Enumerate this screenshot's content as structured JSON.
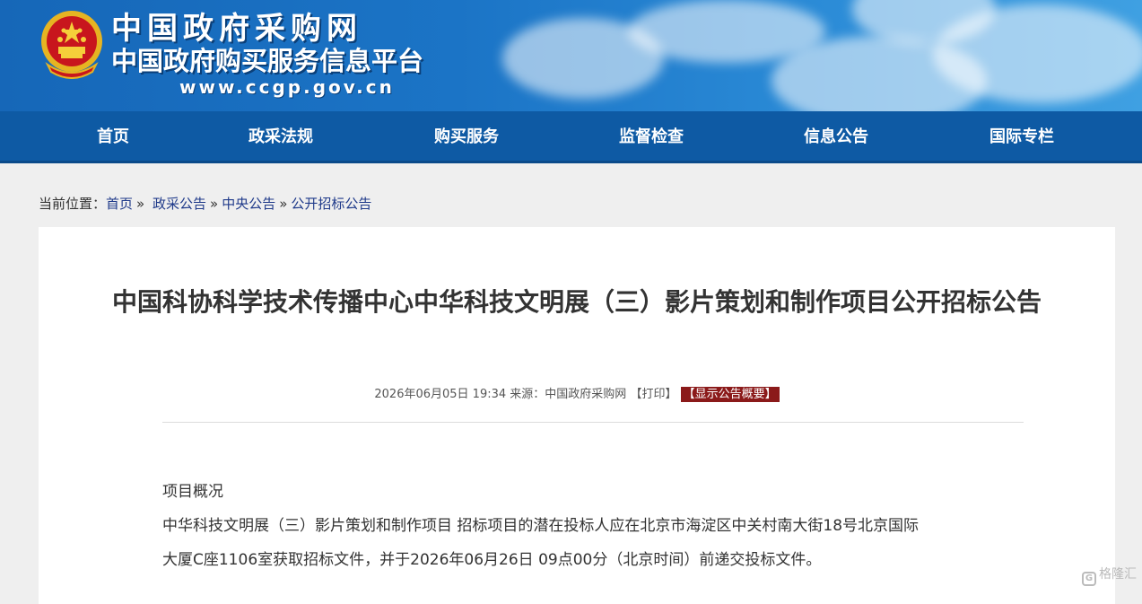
{
  "header": {
    "brand_line1": "中国政府采购网",
    "brand_line2": "中国政府购买服务信息平台",
    "url": "www.ccgp.gov.cn",
    "emblem_icon": "national-emblem-icon"
  },
  "nav": {
    "items": [
      {
        "label": "首页"
      },
      {
        "label": "政采法规"
      },
      {
        "label": "购买服务"
      },
      {
        "label": "监督检查"
      },
      {
        "label": "信息公告"
      },
      {
        "label": "国际专栏"
      }
    ]
  },
  "breadcrumb": {
    "prefix": "当前位置：",
    "items": [
      "首页",
      "政采公告",
      "中央公告",
      "公开招标公告"
    ],
    "separator": "»"
  },
  "article": {
    "title": "中国科协科学技术传播中心中华科技文明展（三）影片策划和制作项目公开招标公告",
    "meta_datetime": "2026年06月05日 19:34",
    "meta_source": "来源：中国政府采购网",
    "print_label": "【打印】",
    "summary_label": "【显示公告概要】",
    "section_heading": "项目概况",
    "body_line1": "中华科技文明展（三）影片策划和制作项目 招标项目的潜在投标人应在北京市海淀区中关村南大街18号北京国际",
    "body_line2": "大厦C座1106室获取招标文件，并于2026年06月26日 09点00分（北京时间）前递交投标文件。"
  },
  "watermark": {
    "text": "格隆汇"
  },
  "colors": {
    "banner": "#1b74c6",
    "nav": "#0e5aa4",
    "summary_badge": "#8b1a1a",
    "link": "#1f3a8a"
  }
}
